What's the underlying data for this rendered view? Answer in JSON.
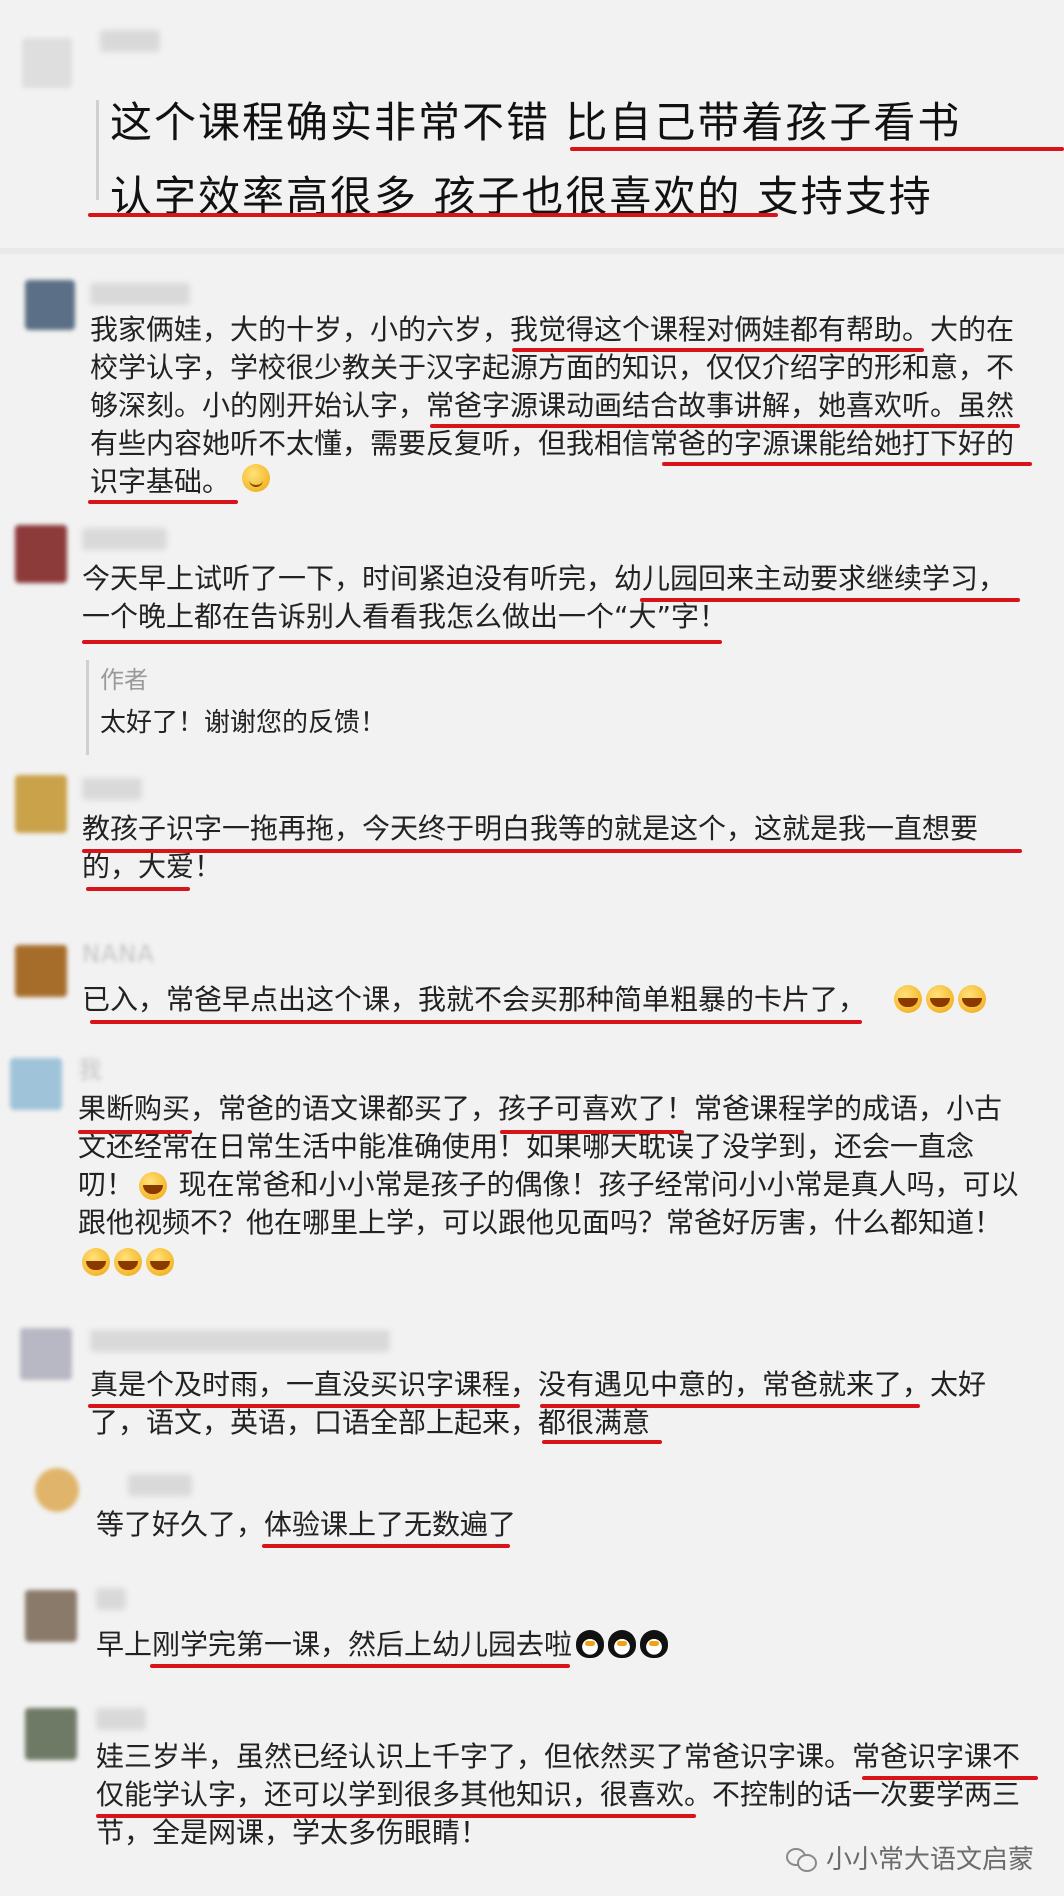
{
  "comments": [
    {
      "text": "这个课程确实非常不错 比自己带着孩子看书\n认字效率高很多 孩子也很喜欢的 支持支持",
      "avatar_color": "#dcdcdc"
    },
    {
      "text": "我家俩娃，大的十岁，小的六岁，我觉得这个课程对俩娃都有帮助。大的在\n校学认字，学校很少教关于汉字起源方面的知识，仅仅介绍字的形和意，不\n够深刻。小的刚开始认字，常爸字源课动画结合故事讲解，她喜欢听。虽然\n有些内容她听不太懂，需要反复听，但我相信常爸的字源课能给她打下好的\n识字基础。",
      "avatar_color": "#5b6f86"
    },
    {
      "text": "今天早上试听了一下，时间紧迫没有听完，幼儿园回来主动要求继续学习，\n一个晚上都在告诉别人看看我怎么做出一个“大”字！",
      "avatar_color": "#8c3a3a",
      "reply_author": "作者",
      "reply_text": "太好了！谢谢您的反馈！"
    },
    {
      "text": "教孩子识字一拖再拖，今天终于明白我等的就是这个，这就是我一直想要\n的，大爱！",
      "avatar_color": "#c9a24a"
    },
    {
      "text": "已入，常爸早点出这个课，我就不会买那种简单粗暴的卡片了，",
      "avatar_color": "#a66d2a",
      "username": "NANA"
    },
    {
      "text": "果断购买，常爸的语文课都买了，孩子可喜欢了！常爸课程学的成语，小古\n文还经常在日常生活中能准确使用！如果哪天耽误了没学到，还会一直念\n叨！     现在常爸和小小常是孩子的偶像！孩子经常问小小常是真人吗，可以\n跟他视频不？他在哪里上学，可以跟他见面吗？常爸好厉害，什么都知道！",
      "avatar_color": "#9fc3d9",
      "username": "我"
    },
    {
      "text": "真是个及时雨，一直没买识字课程，没有遇见中意的，常爸就来了，太好\n了，语文，英语，口语全部上起来，都很满意",
      "avatar_color": "#b8b8c4"
    },
    {
      "text": "等了好久了，体验课上了无数遍了",
      "avatar_color": "#e0b46a"
    },
    {
      "text": "早上刚学完第一课，然后上幼儿园去啦",
      "avatar_color": "#8a7a6a"
    },
    {
      "text": "娃三岁半，虽然已经认识上千字了，但依然买了常爸识字课。常爸识字课不\n仅能学认字，还可以学到很多其他知识，很喜欢。不控制的话一次要学两三\n节，全是网课，学太多伤眼睛！",
      "avatar_color": "#6f7a66"
    }
  ],
  "watermark": {
    "label": "小小常大语文启蒙",
    "icon": "wechat-icon"
  },
  "colors": {
    "underline": "#d8141b",
    "background": "#f2f2f2"
  }
}
